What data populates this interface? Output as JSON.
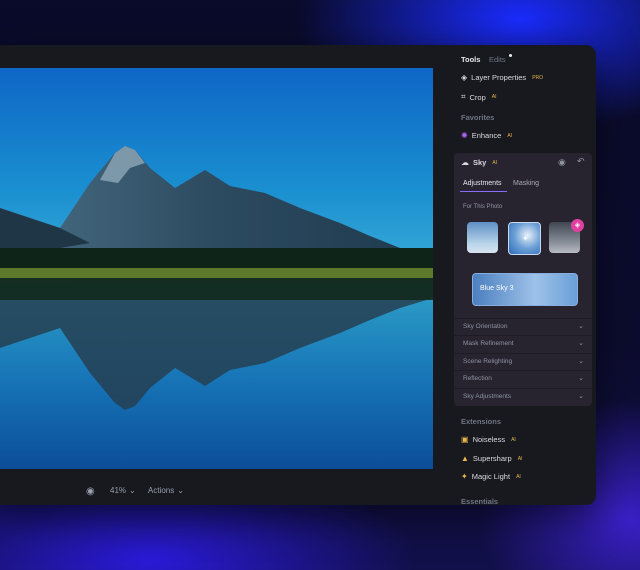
{
  "panel": {
    "tabs": [
      {
        "label": "Tools"
      },
      {
        "label": "Edits"
      }
    ],
    "items": [
      {
        "label": "Layer Properties",
        "badge": "PRO",
        "icon": "layers-icon"
      },
      {
        "label": "Crop",
        "badge": "AI",
        "icon": "crop-icon"
      }
    ],
    "favorites_title": "Favorites",
    "favorites": [
      {
        "label": "Enhance",
        "badge": "AI",
        "icon": "enhance-icon"
      }
    ],
    "sky": {
      "title": "Sky",
      "badge": "AI",
      "subtabs": [
        {
          "label": "Adjustments"
        },
        {
          "label": "Masking"
        }
      ],
      "for_photo": "For This Photo",
      "selected_preset": "Blue Sky 3",
      "accordions": [
        {
          "label": "Sky Orientation"
        },
        {
          "label": "Mask Refinement"
        },
        {
          "label": "Scene Relighting"
        },
        {
          "label": "Reflection"
        },
        {
          "label": "Sky Adjustments"
        }
      ]
    },
    "extensions_title": "Extensions",
    "extensions": [
      {
        "label": "Noiseless",
        "badge": "AI",
        "icon": "noiseless-icon"
      },
      {
        "label": "Supersharp",
        "badge": "AI",
        "icon": "supersharp-icon"
      },
      {
        "label": "Magic Light",
        "badge": "AI",
        "icon": "magic-light-icon"
      }
    ],
    "essentials_title": "Essentials"
  },
  "bottom": {
    "zoom": "41%",
    "actions": "Actions"
  },
  "colors": {
    "accent": "#b366ff",
    "badge": "#e8b84a",
    "cart": "#e040a0"
  }
}
